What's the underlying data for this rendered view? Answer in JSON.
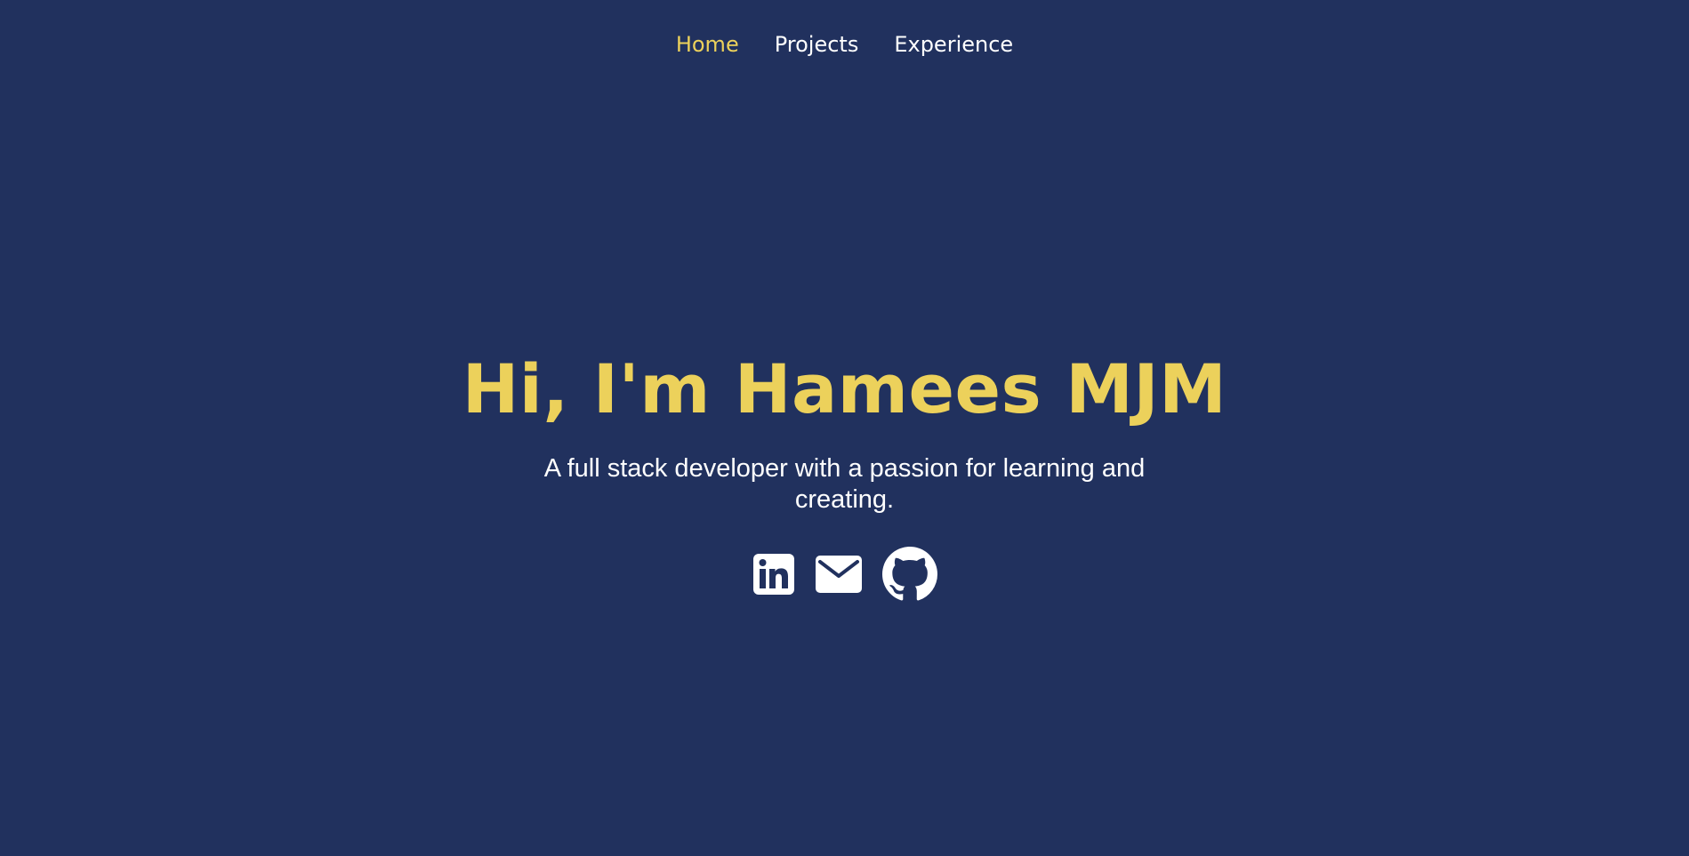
{
  "nav": {
    "items": [
      {
        "label": "Home",
        "active": true
      },
      {
        "label": "Projects",
        "active": false
      },
      {
        "label": "Experience",
        "active": false
      }
    ]
  },
  "hero": {
    "title": "Hi, I'm Hamees MJM",
    "tagline": "A full stack developer with a passion for learning and creating."
  },
  "socials": [
    {
      "icon": "linkedin-icon"
    },
    {
      "icon": "mail-icon"
    },
    {
      "icon": "github-icon"
    }
  ],
  "colors": {
    "background": "#21315e",
    "accent": "#ecd15b",
    "text": "#ffffff"
  }
}
